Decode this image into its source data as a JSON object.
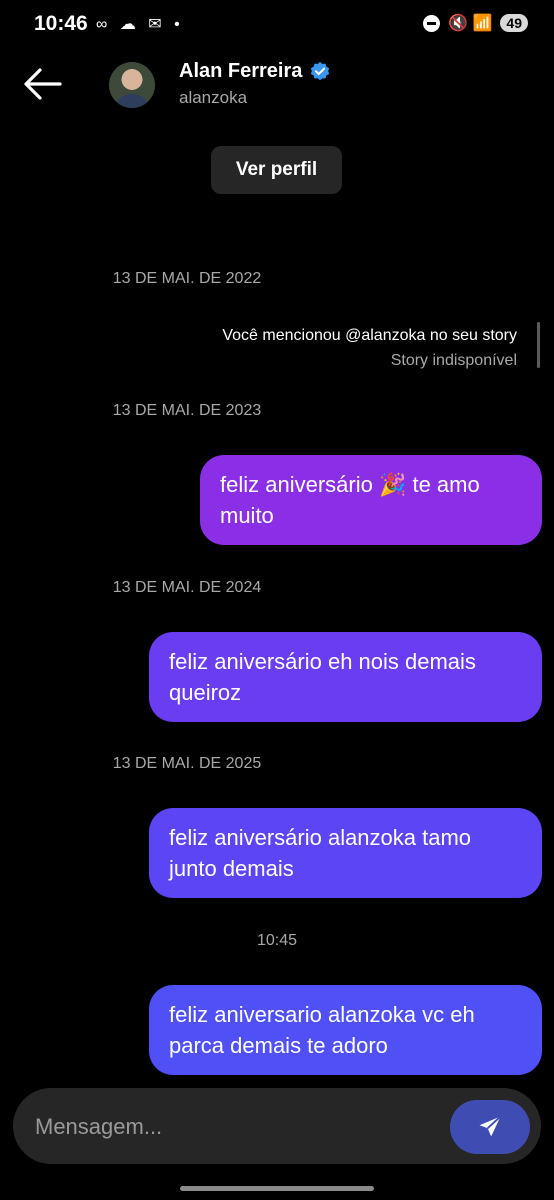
{
  "status_bar": {
    "time": "10:46",
    "left_icons": "∞ ☁ ✉ •",
    "right_icons": "🔇 📶",
    "battery": "49"
  },
  "header": {
    "name": "Alan Ferreira",
    "username": "alanzoka",
    "verified": true,
    "back_icon": "arrow-left-icon"
  },
  "profile_button": "Ver perfil",
  "thread": {
    "date1": "13 DE MAI. DE 2022",
    "story_mention": "Você mencionou @alanzoka no seu story",
    "story_status": "Story indisponível",
    "date2": "13 DE MAI. DE 2023",
    "msg1": "feliz aniversário 🎉 te amo muito",
    "date3": "13 DE MAI. DE 2024",
    "msg2": "feliz aniversário eh nois demais queiroz",
    "date4": "13 DE MAI. DE 2025",
    "msg3": "feliz aniversário alanzoka tamo junto demais",
    "time5": "10:45",
    "msg4": "feliz aniversario alanzoka vc eh parca demais te adoro"
  },
  "composer": {
    "placeholder": "Mensagem...",
    "send_icon": "paper-plane-icon"
  },
  "colors": {
    "bubble1": "#8b2fe6",
    "bubble2": "#6a3cf2",
    "bubble3": "#5b45f5",
    "bubble4": "#4f50f6",
    "verified": "#3897f0"
  }
}
